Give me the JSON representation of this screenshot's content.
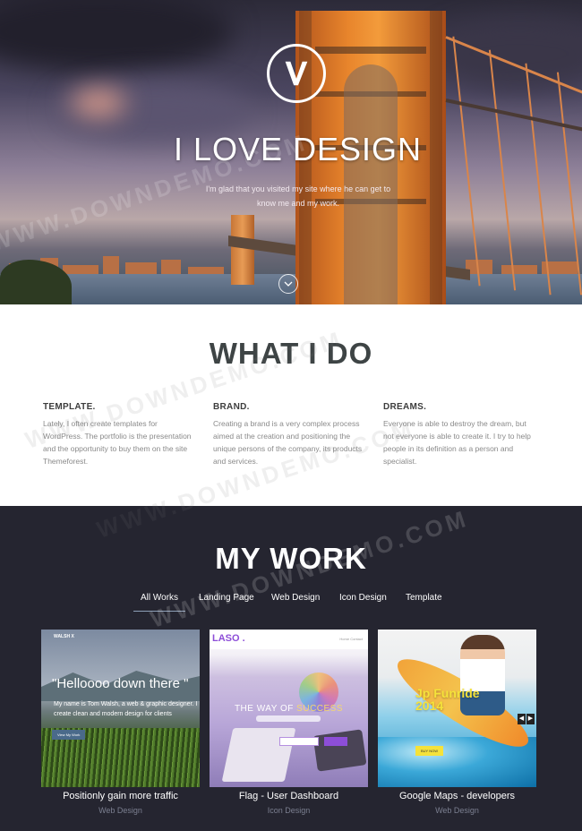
{
  "hero": {
    "title": "I LOVE DESIGN",
    "subtitle": "I'm glad that you visited my site where he can get to know me and my work.",
    "logo_letter": "V"
  },
  "what_i_do": {
    "title": "WHAT I DO",
    "columns": [
      {
        "heading": "TEMPLATE.",
        "text": "Lately, I often create templates for WordPress. The portfolio is the presentation and the opportunity to buy them on the site Themeforest."
      },
      {
        "heading": "BRAND.",
        "text": "Creating a brand is a very complex process aimed at the creation and positioning the unique persons of the company, its products and services."
      },
      {
        "heading": "DREAMS.",
        "text": "Everyone is able to destroy the dream, but not everyone is able to create it. I try to help people in its definition as a person and specialist."
      }
    ]
  },
  "my_work": {
    "title": "MY WORK",
    "filters": [
      "All Works",
      "Landing Page",
      "Web Design",
      "Icon Design",
      "Template"
    ],
    "active_filter": "All Works",
    "items": [
      {
        "caption": "Positionly gain more traffic",
        "category": "Web Design",
        "thumb": {
          "brand": "WALSH X",
          "headline": "\"Helloooo down there \"",
          "body": "My name is Tom Walsh, a web & graphic designer. I create clean and modern design for clients",
          "button": "View My Work"
        }
      },
      {
        "caption": "Flag - User Dashboard",
        "category": "Icon Design",
        "thumb": {
          "brand": "LASO .",
          "nav": "Home   Contact",
          "headline_a": "THE WAY OF ",
          "headline_b": "SUCCESS"
        }
      },
      {
        "caption": "Google Maps - developers",
        "category": "Web Design",
        "thumb": {
          "headline": "Jp Funride 2014",
          "button": "BUY NOW"
        }
      }
    ]
  },
  "watermark": "WWW.DOWNDEMO.COM",
  "colors": {
    "dark_bg": "#252530",
    "accent_purple": "#8d4ed8",
    "hero_orange": "#e8852c"
  }
}
